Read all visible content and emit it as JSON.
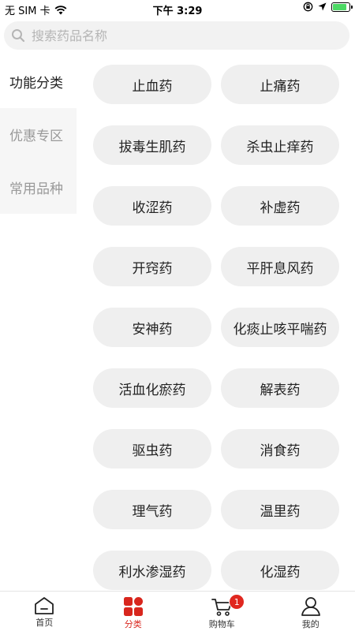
{
  "status_bar": {
    "carrier": "无 SIM 卡",
    "time": "下午 3:29",
    "battery_level": 0.85
  },
  "search": {
    "placeholder": "搜索药品名称"
  },
  "sidebar": {
    "items": [
      {
        "label": "功能分类",
        "active": true
      },
      {
        "label": "优惠专区",
        "active": false
      },
      {
        "label": "常用品种",
        "active": false
      }
    ]
  },
  "categories": [
    "止血药",
    "止痛药",
    "拔毒生肌药",
    "杀虫止痒药",
    "收涩药",
    "补虚药",
    "开窍药",
    "平肝息风药",
    "安神药",
    "化痰止咳平喘药",
    "活血化瘀药",
    "解表药",
    "驱虫药",
    "消食药",
    "理气药",
    "温里药",
    "利水渗湿药",
    "化湿药"
  ],
  "tabbar": {
    "tabs": [
      {
        "label": "首页",
        "icon": "home-icon"
      },
      {
        "label": "分类",
        "icon": "category-icon"
      },
      {
        "label": "购物车",
        "icon": "cart-icon",
        "badge": "1"
      },
      {
        "label": "我的",
        "icon": "profile-icon"
      }
    ],
    "active_index": 1
  },
  "colors": {
    "accent": "#d8261d",
    "pill_bg": "#efefef",
    "sidebar_bg": "#f6f6f6"
  }
}
